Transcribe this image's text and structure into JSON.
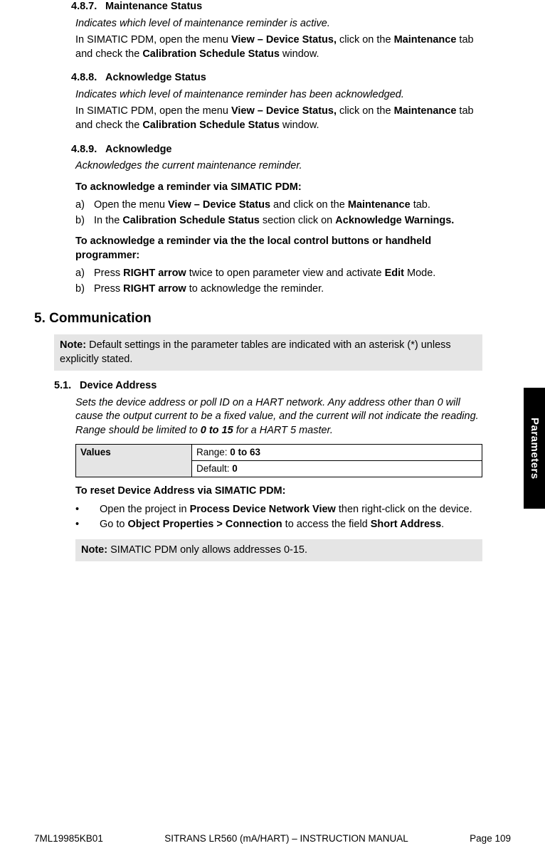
{
  "sections": {
    "s487": {
      "num": "4.8.7.",
      "title": "Maintenance Status",
      "desc": "Indicates which level of maintenance reminder is active.",
      "p1a": "In SIMATIC PDM, open the menu ",
      "p1b": "View – Device Status,",
      "p1c": " click on the ",
      "p1d": "Maintenance",
      "p1e": " tab and check the ",
      "p1f": "Calibration Schedule Status",
      "p1g": " window."
    },
    "s488": {
      "num": "4.8.8.",
      "title": "Acknowledge Status",
      "desc": "Indicates which level of maintenance reminder has been acknowledged.",
      "p1a": "In SIMATIC PDM, open the menu ",
      "p1b": "View – Device Status,",
      "p1c": " click on the ",
      "p1d": "Maintenance",
      "p1e": " tab and check the ",
      "p1f": "Calibration Schedule Status",
      "p1g": " window."
    },
    "s489": {
      "num": "4.8.9.",
      "title": "Acknowledge",
      "desc": "Acknowledges the current maintenance reminder.",
      "sub1": "To acknowledge a reminder via SIMATIC PDM:",
      "a": {
        "pre": "Open the menu ",
        "b1": "View – Device Status",
        "mid": " and click on the ",
        "b2": "Maintenance",
        "post": " tab."
      },
      "b": {
        "pre": "In the ",
        "b1": "Calibration Schedule Status",
        "mid": " section click on ",
        "b2": "Acknowledge Warnings."
      },
      "sub2": "To acknowledge a reminder via the the local control buttons or handheld programmer:",
      "c": {
        "pre": "Press ",
        "b1": "RIGHT arrow ",
        "mid": " twice to open parameter view and activate ",
        "b2": "Edit",
        "post": " Mode."
      },
      "d": {
        "pre": "Press ",
        "b1": "RIGHT arrow ",
        "post": " to acknowledge the reminder."
      }
    }
  },
  "h5": "5. Communication",
  "note1_label": "Note:",
  "note1": " Default settings in the parameter tables are indicated with an asterisk (*) unless explicitly stated.",
  "s51": {
    "num": "5.1.",
    "title": "Device Address",
    "desc_a": "Sets the device address or poll ID on a HART network. Any address other than 0 will cause the output current to be a fixed value, and the current will not indicate the reading. Range should be limited to ",
    "desc_b": "0 to 15",
    "desc_c": " for a HART 5 master.",
    "values_label": "Values",
    "range_label": "Range: ",
    "range_val": "0 to 63",
    "default_label": "Default: ",
    "default_val": "0",
    "sub": "To reset Device Address via SIMATIC PDM:",
    "bul1a": "Open the project in ",
    "bul1b": "Process Device Network View",
    "bul1c": " then right-click on the device.",
    "bul2a": "Go to ",
    "bul2b": "Object Properties > Connection",
    "bul2c": " to access the field ",
    "bul2d": "Short Address",
    "bul2e": "."
  },
  "note2_label": "Note:",
  "note2": " SIMATIC PDM only allows addresses 0-15.",
  "sidetab": "Parameters",
  "footer_left": "7ML19985KB01",
  "footer_center": "SITRANS LR560 (mA/HART) – INSTRUCTION MANUAL",
  "footer_right": "Page 109",
  "marks": {
    "a": "a)",
    "b": "b)",
    "bullet": "•"
  }
}
